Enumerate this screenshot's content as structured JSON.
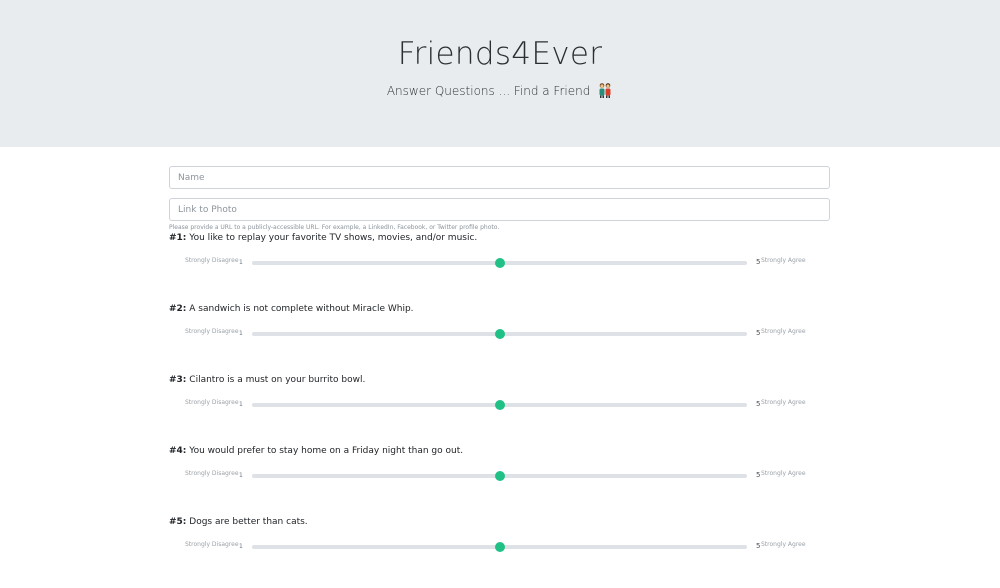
{
  "header": {
    "title": "Friends4Ever",
    "subtitle": "Answer Questions ... Find a Friend",
    "subtitle_icon": "two-people-icon"
  },
  "form": {
    "name_placeholder": "Name",
    "photo_placeholder": "Link to Photo",
    "photo_help": "Please provide a URL to a publicly-accessible URL. For example, a LinkedIn, Facebook, or Twitter profile photo."
  },
  "questions": [
    {
      "number": "#1:",
      "text": "You like to replay your favorite TV shows, movies, and/or music.",
      "min_label": "Strongly Disagree",
      "min_value": "1",
      "max_value": "5",
      "max_label": "Strongly Agree",
      "value": 3
    },
    {
      "number": "#2:",
      "text": "A sandwich is not complete without Miracle Whip.",
      "min_label": "Strongly Disagree",
      "min_value": "1",
      "max_value": "5",
      "max_label": "Strongly Agree",
      "value": 3
    },
    {
      "number": "#3:",
      "text": "Cilantro is a must on your burrito bowl.",
      "min_label": "Strongly Disagree",
      "min_value": "1",
      "max_value": "5",
      "max_label": "Strongly Agree",
      "value": 3
    },
    {
      "number": "#4:",
      "text": "You would prefer to stay home on a Friday night than go out.",
      "min_label": "Strongly Disagree",
      "min_value": "1",
      "max_value": "5",
      "max_label": "Strongly Agree",
      "value": 3
    },
    {
      "number": "#5:",
      "text": "Dogs are better than cats.",
      "min_label": "Strongly Disagree",
      "min_value": "1",
      "max_value": "5",
      "max_label": "Strongly Agree",
      "value": 3
    }
  ],
  "colors": {
    "hero_bg": "#e9ecef",
    "slider_thumb": "#21c087",
    "slider_track": "#dee2e6"
  }
}
